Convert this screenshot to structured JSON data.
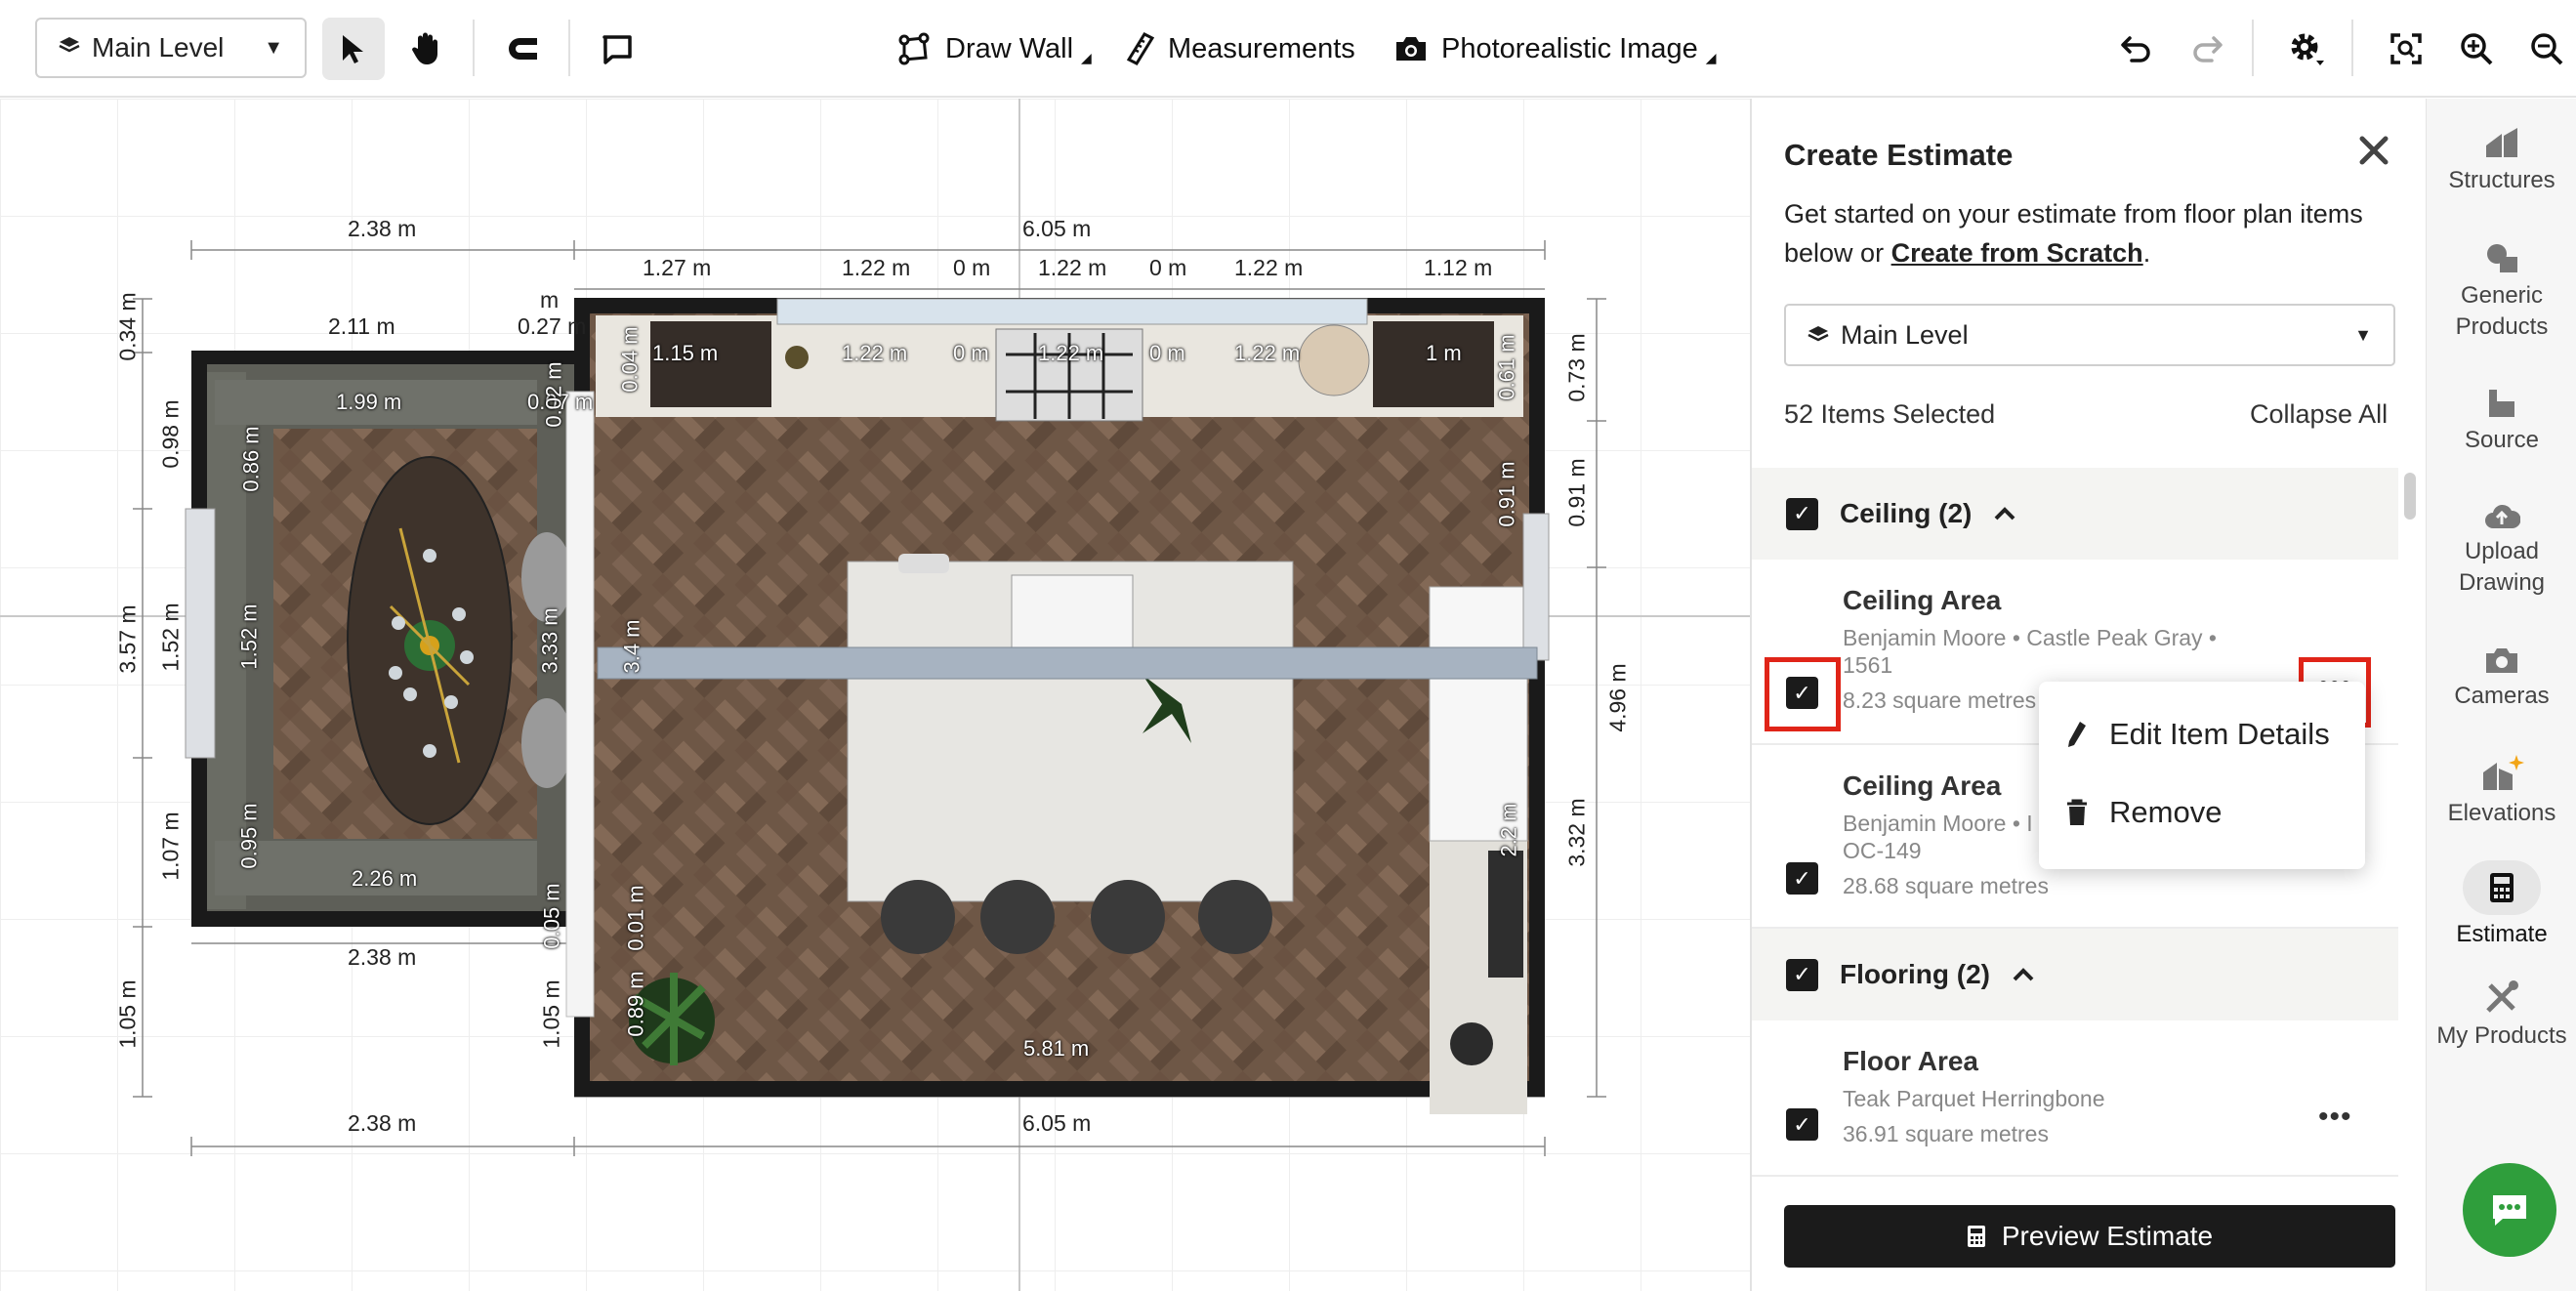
{
  "toolbar": {
    "level": "Main Level",
    "draw_wall": "Draw Wall",
    "measurements": "Measurements",
    "photo": "Photorealistic Image"
  },
  "canvas": {
    "dims": {
      "top_left": "2.38 m",
      "top_total": "6.05 m",
      "top1": "1.27 m",
      "top2": "1.22 m",
      "top3": "0 m",
      "top4": "1.22 m",
      "top5": "0 m",
      "top6": "1.22 m",
      "top7": "1.12 m",
      "dr_top": "2.11 m",
      "dr_top2": "0.27 m",
      "dr_small": "m",
      "bot_left": "2.38 m",
      "bot_left2": "2.38 m",
      "bot_total": "6.05 m",
      "l1": "0.34 m",
      "l2": "0.98 m",
      "l3": "3.57 m",
      "l4": "1.52 m",
      "l5": "1.07 m",
      "l6": "1.05 m",
      "l7": "1.05 m",
      "r1": "0.73 m",
      "r2": "0.91 m",
      "r3": "4.96 m",
      "r4": "3.32 m"
    },
    "labels": {
      "k1": "1.15 m",
      "k2": "1.22 m",
      "k3": "0 m",
      "k4": "1.22 m",
      "k5": "0 m",
      "k6": "1.22 m",
      "k7": "1 m",
      "d1": "1.99 m",
      "d2": "0.07 m",
      "d3": "0.86 m",
      "d4": "1.52 m",
      "d5": "0.95 m",
      "d6": "2.26 m",
      "d7": "3.33 m",
      "d8": "0.04 m",
      "d9": "0.02 m",
      "d10": "0.05 m",
      "d11": "3.4 m",
      "d12": "0.91 m",
      "d13": "0.61 m",
      "d14": "0.01 m",
      "d15": "0.89 m",
      "d16": "5.81 m",
      "d17": "2.2 m"
    }
  },
  "panel": {
    "title": "Create Estimate",
    "intro": "Get started on your estimate from floor plan items below or",
    "intro_link": "Create from Scratch",
    "intro_end": ".",
    "level": "Main Level",
    "count": "52 Items Selected",
    "collapse": "Collapse All",
    "groups": [
      {
        "label": "Ceiling (2)",
        "items": [
          {
            "name": "Ceiling Area",
            "desc": "Benjamin Moore • Castle Peak Gray •",
            "desc2": "1561",
            "area": "8.23 square metres"
          },
          {
            "name": "Ceiling Area",
            "desc": "Benjamin Moore • I",
            "desc2": "OC-149",
            "area": "28.68 square metres"
          }
        ]
      },
      {
        "label": "Flooring (2)",
        "items": [
          {
            "name": "Floor Area",
            "desc": "Teak Parquet Herringbone",
            "area": "36.91 square metres"
          }
        ]
      }
    ],
    "menu": {
      "edit": "Edit Item Details",
      "remove": "Remove"
    },
    "preview": "Preview Estimate"
  },
  "nav": {
    "structures": "Structures",
    "generic": "Generic Products",
    "source": "Source",
    "upload": "Upload Drawing",
    "cameras": "Cameras",
    "elevations": "Elevations",
    "estimate": "Estimate",
    "myproducts": "My Products"
  }
}
